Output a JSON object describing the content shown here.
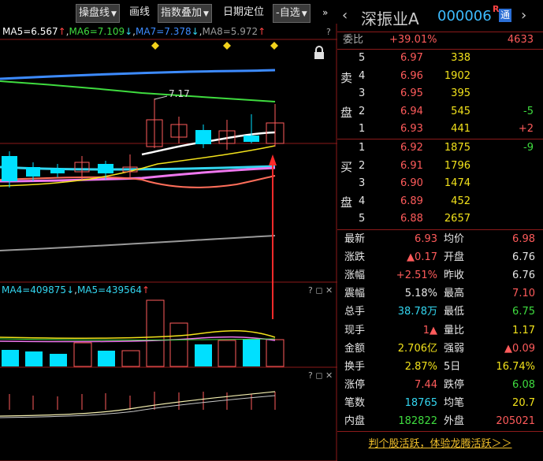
{
  "toolbar": {
    "kline_type": "操盘线",
    "draw_line": "画线",
    "index_overlay": "指数叠加",
    "date_locate": "日期定位",
    "watchlist": "-自选"
  },
  "chart": {
    "ma_line": [
      {
        "text": "MA5=6.567",
        "arrow": "↑",
        "color": "#ffffff",
        "arrow_color": "#ff4444"
      },
      {
        "text": "MA6=7.109",
        "arrow": "↓",
        "color": "#3fdc3f",
        "arrow_color": "#33d6f0"
      },
      {
        "text": "MA7=7.378",
        "arrow": "↓",
        "color": "#3d8bff",
        "arrow_color": "#33d6f0"
      },
      {
        "text": "MA8=5.972",
        "arrow": "↑",
        "color": "#9a9a9a",
        "arrow_color": "#ff4444"
      }
    ],
    "high_label": "7.17",
    "volume_ma": [
      {
        "text": "MA4=409875",
        "arrow": "↓",
        "color": "#33d6f0",
        "arrow_color": "#33d6f0"
      },
      {
        "text": "MA5=439564",
        "arrow": "↑",
        "color": "#33d6f0",
        "arrow_color": "#ff4444"
      }
    ],
    "panel_controls": "? ◻ ✕",
    "top_control": "?"
  },
  "quote": {
    "name": "深振业A",
    "code": "000006",
    "r_mark": "R",
    "tong_mark": "通",
    "weibi_label": "委比",
    "weibi_pct": "+39.01%",
    "weibi_diff": "4633",
    "sell_label": [
      "卖",
      "盘"
    ],
    "buy_label": [
      "买",
      "盘"
    ],
    "asks": [
      {
        "level": "5",
        "price": "6.97",
        "vol": "338",
        "chg": ""
      },
      {
        "level": "4",
        "price": "6.96",
        "vol": "1902",
        "chg": ""
      },
      {
        "level": "3",
        "price": "6.95",
        "vol": "395",
        "chg": ""
      },
      {
        "level": "2",
        "price": "6.94",
        "vol": "545",
        "chg": "-5"
      },
      {
        "level": "1",
        "price": "6.93",
        "vol": "441",
        "chg": "+2"
      }
    ],
    "bids": [
      {
        "level": "1",
        "price": "6.92",
        "vol": "1875",
        "chg": "-9"
      },
      {
        "level": "2",
        "price": "6.91",
        "vol": "1796",
        "chg": ""
      },
      {
        "level": "3",
        "price": "6.90",
        "vol": "1474",
        "chg": ""
      },
      {
        "level": "4",
        "price": "6.89",
        "vol": "452",
        "chg": ""
      },
      {
        "level": "5",
        "price": "6.88",
        "vol": "2657",
        "chg": ""
      }
    ],
    "stats": [
      {
        "l1": "最新",
        "v1": "6.93",
        "c1": "red",
        "l2": "均价",
        "v2": "6.98",
        "c2": "red"
      },
      {
        "l1": "涨跌",
        "v1": "▲0.17",
        "c1": "red",
        "l2": "开盘",
        "v2": "6.76",
        "c2": "white"
      },
      {
        "l1": "涨幅",
        "v1": "+2.51%",
        "c1": "red",
        "l2": "昨收",
        "v2": "6.76",
        "c2": "white"
      },
      {
        "l1": "震幅",
        "v1": "5.18%",
        "c1": "white",
        "l2": "最高",
        "v2": "7.10",
        "c2": "red"
      },
      {
        "l1": "总手",
        "v1": "38.78万",
        "c1": "cyan",
        "l2": "最低",
        "v2": "6.75",
        "c2": "green"
      },
      {
        "l1": "现手",
        "v1": "1▲",
        "c1": "red",
        "l2": "量比",
        "v2": "1.17",
        "c2": "yellow"
      },
      {
        "l1": "金额",
        "v1": "2.706亿",
        "c1": "yellow",
        "l2": "强弱",
        "v2": "▲0.09",
        "c2": "red"
      },
      {
        "l1": "换手",
        "v1": "2.87%",
        "c1": "yellow",
        "l2": "5日",
        "v2": "16.74%",
        "c2": "yellow"
      },
      {
        "l1": "涨停",
        "v1": "7.44",
        "c1": "red",
        "l2": "跌停",
        "v2": "6.08",
        "c2": "green"
      },
      {
        "l1": "笔数",
        "v1": "18765",
        "c1": "cyan",
        "l2": "均笔",
        "v2": "20.7",
        "c2": "yellow"
      },
      {
        "l1": "内盘",
        "v1": "182822",
        "c1": "green",
        "l2": "外盘",
        "v2": "205021",
        "c2": "red"
      }
    ],
    "promo": "判个股活跃，体验龙腾活跃＞＞"
  },
  "colors": {
    "up": "#ff4444",
    "down": "#00e0ff",
    "divider": "#8b1a1a",
    "accent": "#3dbcff"
  }
}
